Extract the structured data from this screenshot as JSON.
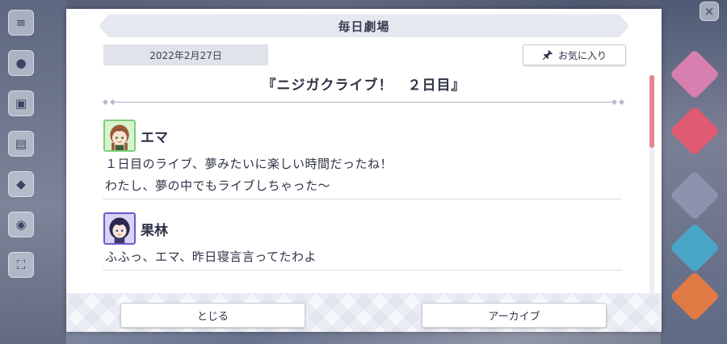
{
  "dialog": {
    "title": "毎日劇場",
    "date": "2022年2月27日",
    "favorite_label": "お気に入り",
    "story_title": "『ニジガクライブ！　２日目』",
    "entries": [
      {
        "speaker": "エマ",
        "avatar": "emma-avatar",
        "lines": [
          "１日目のライブ、夢みたいに楽しい時間だったね！",
          "わたし、夢の中でもライブしちゃった〜"
        ]
      },
      {
        "speaker": "果林",
        "avatar": "karin-avatar",
        "lines": [
          "ふふっ、エマ、昨日寝言言ってたわよ"
        ]
      }
    ],
    "close_label": "とじる",
    "archive_label": "アーカイブ"
  },
  "colors": {
    "scroll_thumb": "#e8838f",
    "emma_frame": "#7fcf7a",
    "karin_frame": "#6b5ac9"
  }
}
